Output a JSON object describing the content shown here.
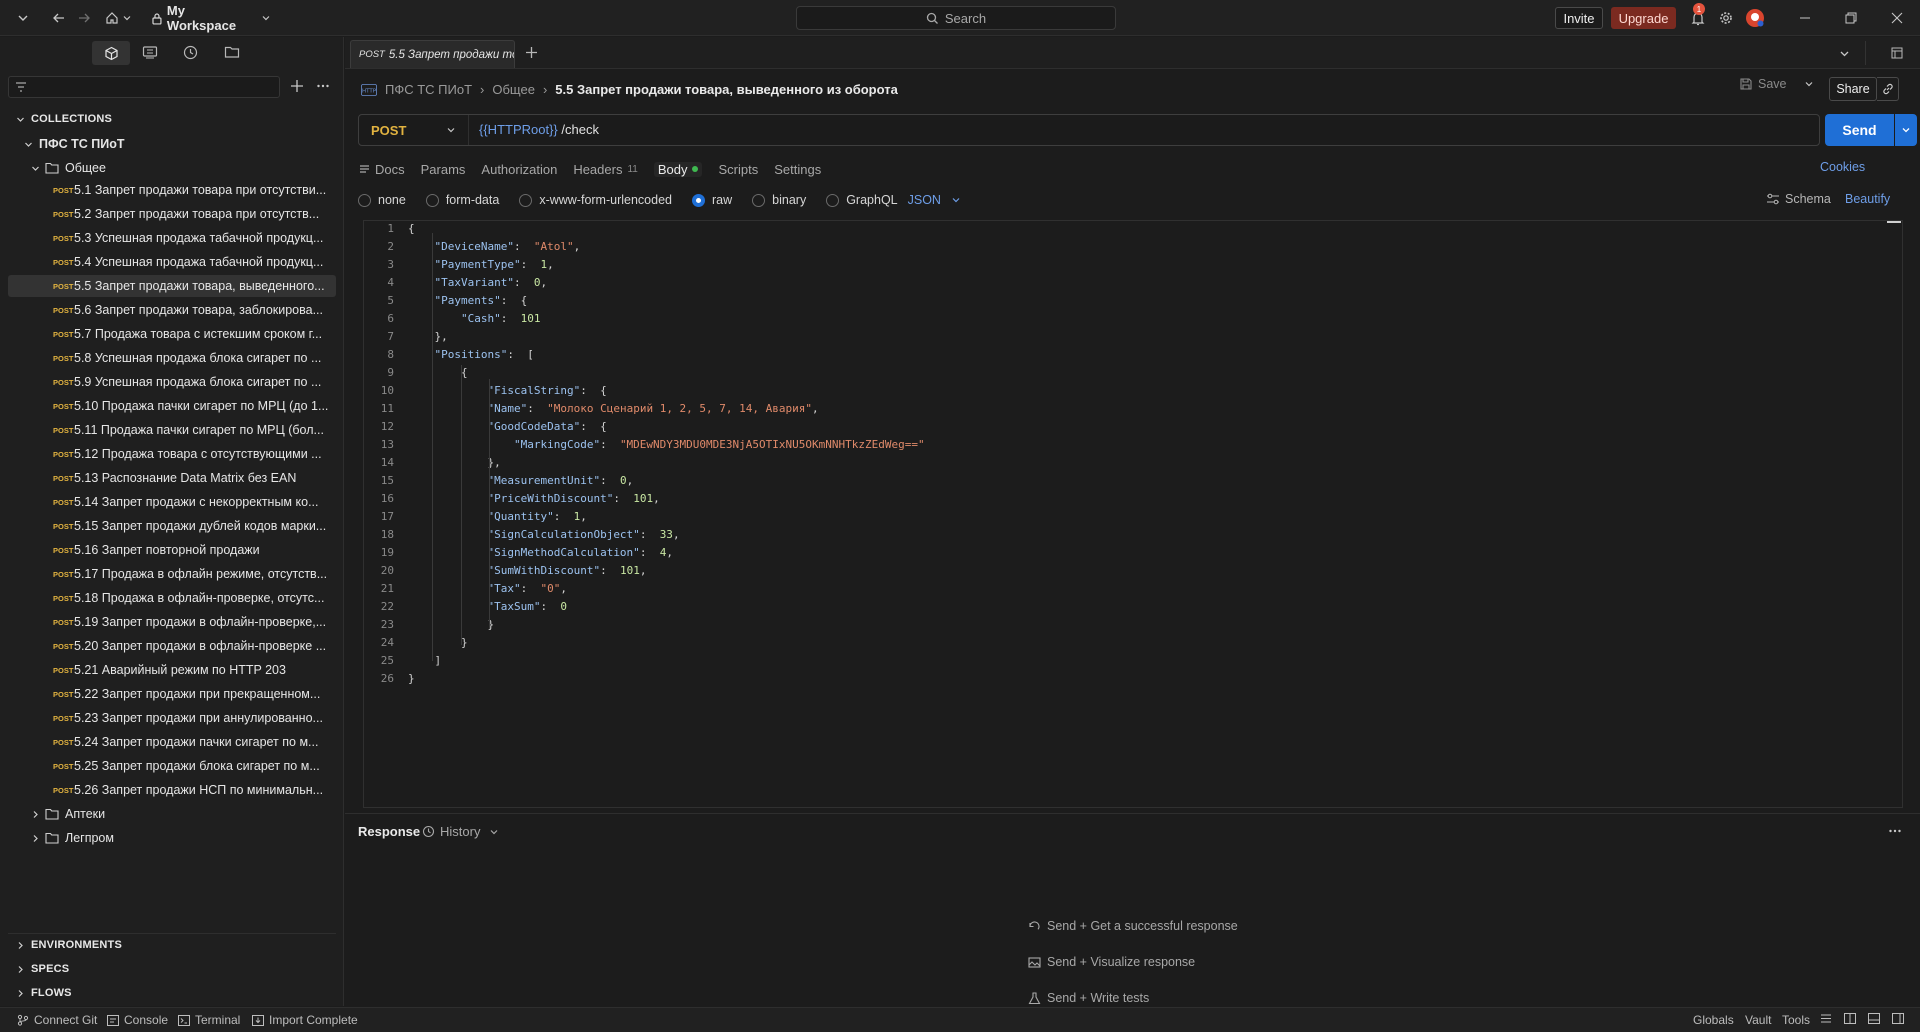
{
  "titlebar": {
    "workspace": "My Workspace",
    "search_placeholder": "Search",
    "invite": "Invite",
    "upgrade": "Upgrade",
    "notifications_count": "1"
  },
  "sidebar": {
    "collections_heading": "COLLECTIONS",
    "collection_name": "ПФС ТС ПИоТ",
    "folder_open": "Общее",
    "requests": [
      {
        "method": "POST",
        "name": "5.1 Запрет продажи товара при отсутстви..."
      },
      {
        "method": "POST",
        "name": "5.2 Запрет продажи товара при отсутств..."
      },
      {
        "method": "POST",
        "name": "5.3 Успешная продажа табачной продукц..."
      },
      {
        "method": "POST",
        "name": "5.4 Успешная продажа табачной продукц..."
      },
      {
        "method": "POST",
        "name": "5.5 Запрет продажи товара, выведенного..."
      },
      {
        "method": "POST",
        "name": "5.6 Запрет продажи товара, заблокирова..."
      },
      {
        "method": "POST",
        "name": "5.7 Продажа товара с истекшим сроком г..."
      },
      {
        "method": "POST",
        "name": "5.8 Успешная продажа блока сигарет по ..."
      },
      {
        "method": "POST",
        "name": "5.9 Успешная продажа блока сигарет по ..."
      },
      {
        "method": "POST",
        "name": "5.10 Продажа пачки сигарет по МРЦ (до 1..."
      },
      {
        "method": "POST",
        "name": "5.11 Продажа пачки сигарет по МРЦ (бол..."
      },
      {
        "method": "POST",
        "name": "5.12 Продажа товара с отсутствующими ..."
      },
      {
        "method": "POST",
        "name": "5.13 Распознание Data Matrix без EAN"
      },
      {
        "method": "POST",
        "name": "5.14 Запрет продажи с некорректным ко..."
      },
      {
        "method": "POST",
        "name": "5.15 Запрет продажи дублей кодов марки..."
      },
      {
        "method": "POST",
        "name": "5.16 Запрет повторной продажи"
      },
      {
        "method": "POST",
        "name": "5.17 Продажа в офлайн режиме, отсутств..."
      },
      {
        "method": "POST",
        "name": "5.18 Продажа в офлайн-проверке, отсутс..."
      },
      {
        "method": "POST",
        "name": "5.19 Запрет продажи в офлайн-проверке,..."
      },
      {
        "method": "POST",
        "name": "5.20 Запрет продажи в офлайн-проверке ..."
      },
      {
        "method": "POST",
        "name": "5.21 Аварийный режим по HTTP 203"
      },
      {
        "method": "POST",
        "name": "5.22 Запрет продажи при прекращенном..."
      },
      {
        "method": "POST",
        "name": "5.23 Запрет продажи при аннулированно..."
      },
      {
        "method": "POST",
        "name": "5.24 Запрет продажи пачки сигарет по м..."
      },
      {
        "method": "POST",
        "name": "5.25 Запрет продажи блока сигарет по м..."
      },
      {
        "method": "POST",
        "name": "5.26 Запрет продажи НСП по минимальн..."
      }
    ],
    "folder_2": "Аптеки",
    "folder_3": "Легпром",
    "environments": "ENVIRONMENTS",
    "specs": "SPECS",
    "flows": "FLOWS"
  },
  "tab": {
    "method": "POST",
    "label": "5.5 Запрет продажи то"
  },
  "request": {
    "breadcrumb_1": "ПФС ТС ПИоТ",
    "breadcrumb_2": "Общее",
    "title": "5.5 Запрет продажи товара, выведенного из оборота",
    "save": "Save",
    "share": "Share",
    "method": "POST",
    "url_var": "{{HTTPRoot}}",
    "url_path": " /check",
    "send": "Send",
    "tabs": {
      "docs": "Docs",
      "params": "Params",
      "authorization": "Authorization",
      "headers": "Headers",
      "headers_count": "11",
      "body": "Body",
      "scripts": "Scripts",
      "settings": "Settings"
    },
    "cookies": "Cookies",
    "body_modes": {
      "none": "none",
      "form_data": "form-data",
      "urlencoded": "x-www-form-urlencoded",
      "raw": "raw",
      "binary": "binary",
      "graphql": "GraphQL",
      "format": "JSON"
    },
    "schema": "Schema",
    "beautify": "Beautify"
  },
  "code_lines": [
    {
      "n": "1",
      "t": "{"
    },
    {
      "n": "2",
      "t": "    \"DeviceName\":  \"Atol\","
    },
    {
      "n": "3",
      "t": "    \"PaymentType\":  1,"
    },
    {
      "n": "4",
      "t": "    \"TaxVariant\":  0,"
    },
    {
      "n": "5",
      "t": "    \"Payments\":  {"
    },
    {
      "n": "6",
      "t": "        \"Cash\":  101"
    },
    {
      "n": "7",
      "t": "    },"
    },
    {
      "n": "8",
      "t": "    \"Positions\":  ["
    },
    {
      "n": "9",
      "t": "        {"
    },
    {
      "n": "10",
      "t": "            \"FiscalString\":  {"
    },
    {
      "n": "11",
      "t": "            \"Name\":  \"Молоко Сценарий 1, 2, 5, 7, 14, Авария\","
    },
    {
      "n": "12",
      "t": "            \"GoodCodeData\":  {"
    },
    {
      "n": "13",
      "t": "                \"MarkingCode\":  \"MDEwNDY3MDU0MDE3NjA5OTIxNU5OKmNNHTkzZEdWeg==\""
    },
    {
      "n": "14",
      "t": "            },"
    },
    {
      "n": "15",
      "t": "            \"MeasurementUnit\":  0,"
    },
    {
      "n": "16",
      "t": "            \"PriceWithDiscount\":  101,"
    },
    {
      "n": "17",
      "t": "            \"Quantity\":  1,"
    },
    {
      "n": "18",
      "t": "            \"SignCalculationObject\":  33,"
    },
    {
      "n": "19",
      "t": "            \"SignMethodCalculation\":  4,"
    },
    {
      "n": "20",
      "t": "            \"SumWithDiscount\":  101,"
    },
    {
      "n": "21",
      "t": "            \"Tax\":  \"0\","
    },
    {
      "n": "22",
      "t": "            \"TaxSum\":  0"
    },
    {
      "n": "23",
      "t": "            }"
    },
    {
      "n": "24",
      "t": "        }"
    },
    {
      "n": "25",
      "t": "    ]"
    },
    {
      "n": "26",
      "t": "}"
    }
  ],
  "response": {
    "title": "Response",
    "history": "History",
    "hint_1": "Send + Get a successful response",
    "hint_2": "Send + Visualize response",
    "hint_3": "Send + Write tests"
  },
  "statusbar": {
    "connect_git": "Connect Git",
    "console": "Console",
    "terminal": "Terminal",
    "import_status": "Import Complete",
    "globals": "Globals",
    "vault": "Vault",
    "tools": "Tools"
  },
  "colors": {
    "accent": "#1f6fd6",
    "method_post": "#e2b340",
    "upgrade": "#7b2a20",
    "json_key": "#9cc2ef",
    "json_string": "#e08a6a",
    "json_number": "#c9e7a3"
  }
}
